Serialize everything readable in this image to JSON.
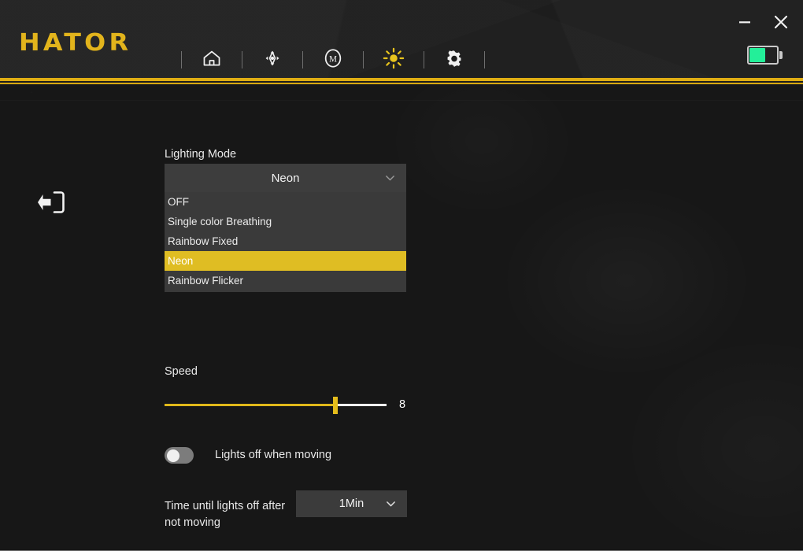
{
  "app": {
    "brand": "HATOR",
    "brand_color": "#e2b41c",
    "accent_color": "#dfbd23"
  },
  "header": {
    "nav_items": [
      {
        "name": "home-icon",
        "label": "Home"
      },
      {
        "name": "dpi-icon",
        "label": "DPI"
      },
      {
        "name": "macro-icon",
        "label": "Macro"
      },
      {
        "name": "lighting-icon",
        "label": "Lighting"
      },
      {
        "name": "settings-icon",
        "label": "Settings"
      }
    ],
    "window": {
      "minimize": "—",
      "close": "✕"
    },
    "battery": {
      "name": "battery-icon",
      "level_percent": 58,
      "color": "#23ef99"
    }
  },
  "main": {
    "back_button": "back-arrow-icon",
    "lighting_mode": {
      "label": "Lighting Mode",
      "selected": "Neon",
      "options": [
        "OFF",
        "Single color Breathing",
        "Rainbow Fixed",
        "Neon",
        "Rainbow Flicker"
      ],
      "selected_index": 3
    },
    "speed": {
      "label": "Speed",
      "value": "8",
      "percent": 77
    },
    "lights_off_when_moving": {
      "label": "Lights off when moving",
      "state": "off"
    },
    "timeout": {
      "label": "Time until lights off after not moving",
      "selected": "1Min"
    }
  }
}
